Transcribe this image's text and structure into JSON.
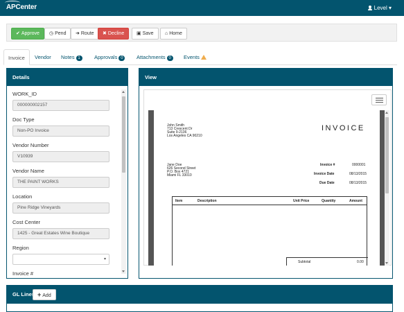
{
  "app": {
    "brand": "APCenter",
    "user_label": "Level"
  },
  "toolbar": {
    "approve": "Approve",
    "pend": "Pend",
    "route": "Route",
    "decline": "Decline",
    "save": "Save",
    "home": "Home"
  },
  "tabs": [
    {
      "label": "Invoice"
    },
    {
      "label": "Vendor"
    },
    {
      "label": "Notes",
      "badge": "1"
    },
    {
      "label": "Approvals",
      "badge": "0"
    },
    {
      "label": "Attachments",
      "badge": "0"
    },
    {
      "label": "Events"
    }
  ],
  "details": {
    "title": "Details",
    "fields": [
      {
        "label": "WORK_ID",
        "value": "000000002157"
      },
      {
        "label": "Doc Type",
        "value": "Non-PO Invoice"
      },
      {
        "label": "Vendor Number",
        "value": "V10939"
      },
      {
        "label": "Vendor Name",
        "value": "THE PAINT WORKS"
      },
      {
        "label": "Location",
        "value": "Pine Ridge Vineyards"
      },
      {
        "label": "Cost Center",
        "value": "1425 - Great Estates Wine Boutique"
      },
      {
        "label": "Region",
        "value": ""
      },
      {
        "label": "Invoice #",
        "value": ""
      }
    ]
  },
  "view": {
    "title": "View",
    "invoice": {
      "heading": "INVOICE",
      "from": [
        "John Smith",
        "713 Crescent Dr",
        "Suite 9-2136",
        "Los Angeles CA 90210"
      ],
      "to": [
        "Jane Doe",
        "626 Second Street",
        "P.O. Box 4721",
        "Miami FL 33010"
      ],
      "meta": [
        {
          "label": "Invoice #",
          "value": "0000001"
        },
        {
          "label": "Invoice Date",
          "value": "08/13/2015"
        },
        {
          "label": "Due Date",
          "value": "08/13/2015"
        }
      ],
      "columns": [
        "Item",
        "Description",
        "Unit Price",
        "Quantity",
        "Amount"
      ],
      "subtotal_label": "Subtotal",
      "subtotal_value": "0.00"
    }
  },
  "gl": {
    "title": "GL Lines",
    "add_label": "Add"
  }
}
